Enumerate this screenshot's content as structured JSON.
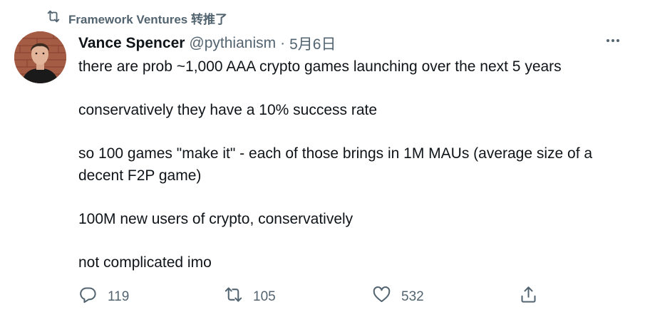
{
  "retweet_context": {
    "text": "Framework Ventures 转推了"
  },
  "tweet": {
    "display_name": "Vance Spencer",
    "handle": "@pythianism",
    "separator": "·",
    "date": "5月6日",
    "paragraphs": [
      "there are prob ~1,000 AAA crypto games launching over the next 5 years",
      "conservatively they have a 10% success rate",
      "so 100 games \"make it\" -  each of those brings in 1M MAUs (average size of a decent F2P game)",
      "100M new users of crypto, conservatively",
      "not complicated imo"
    ]
  },
  "actions": {
    "reply_count": "119",
    "retweet_count": "105",
    "like_count": "532"
  },
  "icons": {
    "retweet_context": "retweet-icon",
    "more": "more-horizontal-icon",
    "reply": "reply-icon",
    "retweet": "retweet-icon",
    "like": "heart-icon",
    "share": "share-icon"
  },
  "colors": {
    "text_primary": "#0f1419",
    "text_secondary": "#536471",
    "background": "#ffffff"
  }
}
